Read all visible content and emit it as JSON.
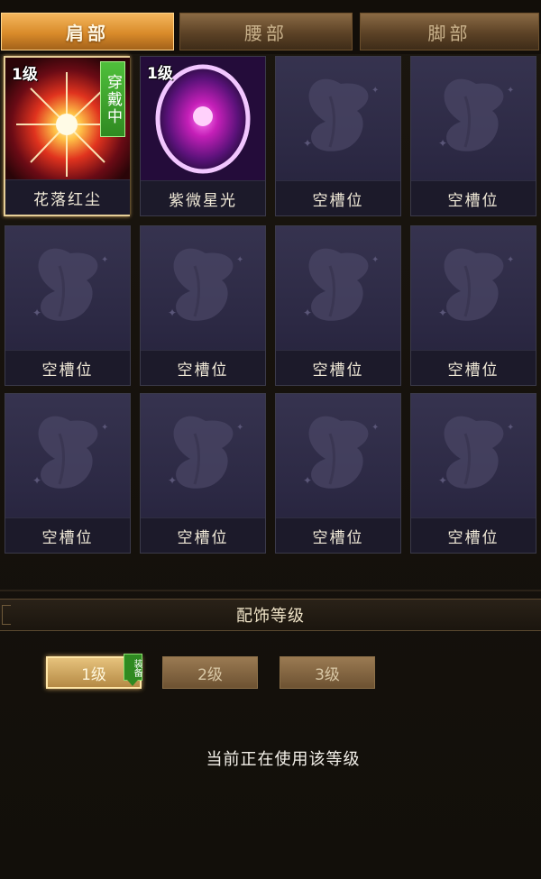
{
  "tabs": [
    {
      "label": "肩部",
      "active": true
    },
    {
      "label": "腰部",
      "active": false
    },
    {
      "label": "脚部",
      "active": false
    }
  ],
  "slots": [
    {
      "level": "1级",
      "name": "花落红尘",
      "badge": "穿戴中",
      "art": "red-starburst",
      "selected": true
    },
    {
      "level": "1级",
      "name": "紫微星光",
      "art": "purple-orb"
    },
    {
      "name": "空槽位",
      "art": "empty"
    },
    {
      "name": "空槽位",
      "art": "empty"
    },
    {
      "name": "空槽位",
      "art": "empty"
    },
    {
      "name": "空槽位",
      "art": "empty"
    },
    {
      "name": "空槽位",
      "art": "empty"
    },
    {
      "name": "空槽位",
      "art": "empty"
    },
    {
      "name": "空槽位",
      "art": "empty"
    },
    {
      "name": "空槽位",
      "art": "empty"
    },
    {
      "name": "空槽位",
      "art": "empty"
    },
    {
      "name": "空槽位",
      "art": "empty"
    }
  ],
  "level_section": {
    "title": "配饰等级",
    "buttons": [
      {
        "label": "1级",
        "active": true
      },
      {
        "label": "2级",
        "active": false
      },
      {
        "label": "3级",
        "active": false
      }
    ],
    "equip_badge": "装备",
    "status": "当前正在使用该等级"
  },
  "colors": {
    "active_tab": "#e09a3a",
    "panel_bg": "#15110c",
    "slot_bg": "#2c2944",
    "badge_green": "#3aa22a"
  }
}
